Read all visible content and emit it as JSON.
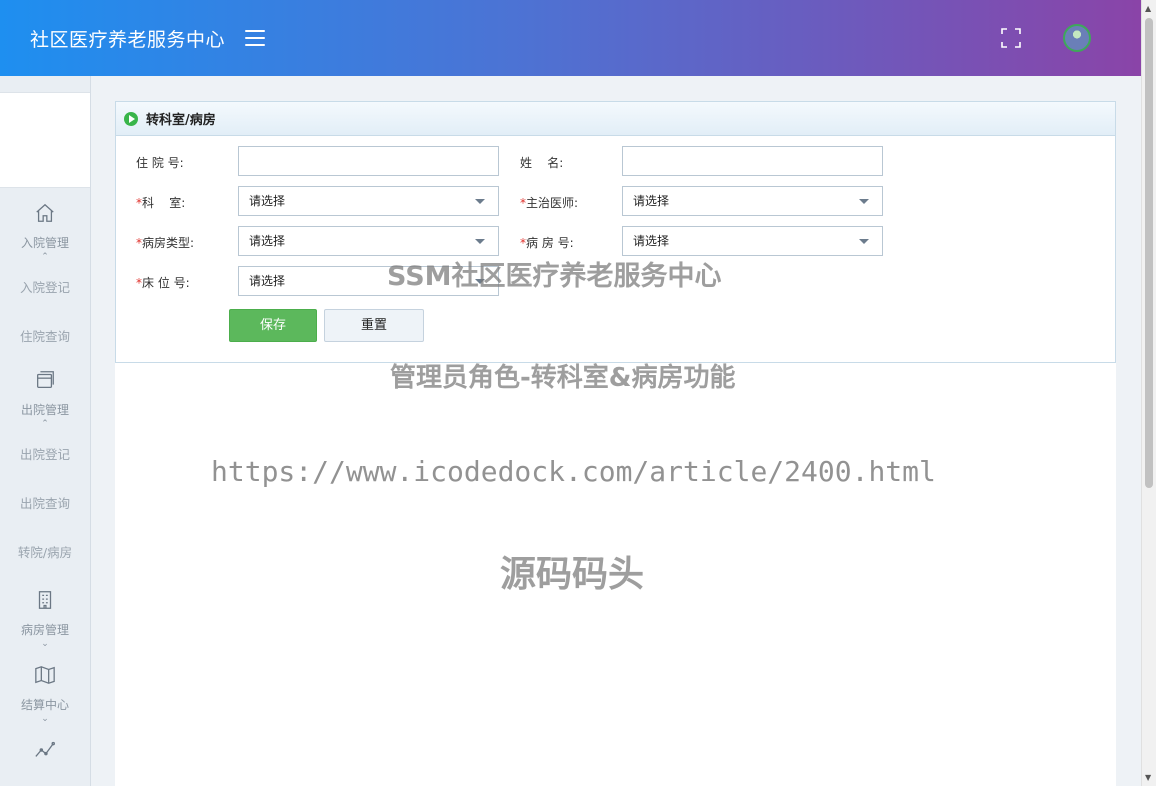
{
  "header": {
    "title": "社区医疗养老服务中心",
    "menu_icon": "hamburger-menu-icon",
    "fullscreen_icon": "fullscreen-icon",
    "avatar_icon": "user-avatar"
  },
  "sidebar": {
    "groups": [
      {
        "label": "入院管理",
        "icon": "home-icon",
        "expanded": true,
        "items": [
          {
            "label": "入院登记"
          },
          {
            "label": "住院查询"
          }
        ]
      },
      {
        "label": "出院管理",
        "icon": "window-icon",
        "expanded": true,
        "items": [
          {
            "label": "出院登记"
          },
          {
            "label": "出院查询"
          },
          {
            "label": "转院/病房"
          }
        ]
      },
      {
        "label": "病房管理",
        "icon": "building-icon",
        "expanded": false
      },
      {
        "label": "结算中心",
        "icon": "map-icon",
        "expanded": false
      },
      {
        "label": "",
        "icon": "line-chart-icon",
        "expanded": false
      }
    ]
  },
  "panel": {
    "title": "转科室/病房",
    "fields": {
      "admission_no": {
        "label": "住 院 号:",
        "value": ""
      },
      "name": {
        "label": "姓    名:",
        "value": ""
      },
      "department": {
        "label": "科    室:",
        "value": "请选择",
        "required": "*"
      },
      "doctor": {
        "label": "主治医师:",
        "value": "请选择",
        "required": "*"
      },
      "ward_type": {
        "label": "病房类型:",
        "value": "请选择",
        "required": "*"
      },
      "ward_no": {
        "label": "病 房 号:",
        "value": "请选择",
        "required": "*"
      },
      "bed_no": {
        "label": "床 位 号:",
        "value": "请选择",
        "required": "*"
      }
    },
    "buttons": {
      "save": "保存",
      "reset": "重置"
    }
  },
  "watermark": {
    "line1": "SSM社区医疗养老服务中心",
    "line2": "管理员角色-转科室&病房功能",
    "line3": "https://www.icodedock.com/article/2400.html",
    "line4": "源码码头"
  },
  "colors": {
    "header_gradient_start": "#1e8ff0",
    "header_gradient_end": "#8a44a8",
    "save_button": "#5cb85c",
    "required_mark": "#e0322c"
  }
}
